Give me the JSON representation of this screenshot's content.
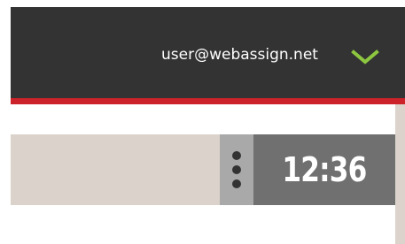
{
  "header": {
    "user_email": "user@webassign.net",
    "menu_icon": "chevron-down-icon"
  },
  "timer": {
    "display": "12:36",
    "menu_icon": "vertical-dots-icon"
  },
  "colors": {
    "header_bg": "#333333",
    "accent_red": "#cc2229",
    "chevron_green": "#8dc63f",
    "timer_bg": "#707070",
    "handle_bg": "#a9a9a9",
    "bar_bg": "#dbd3cb"
  }
}
